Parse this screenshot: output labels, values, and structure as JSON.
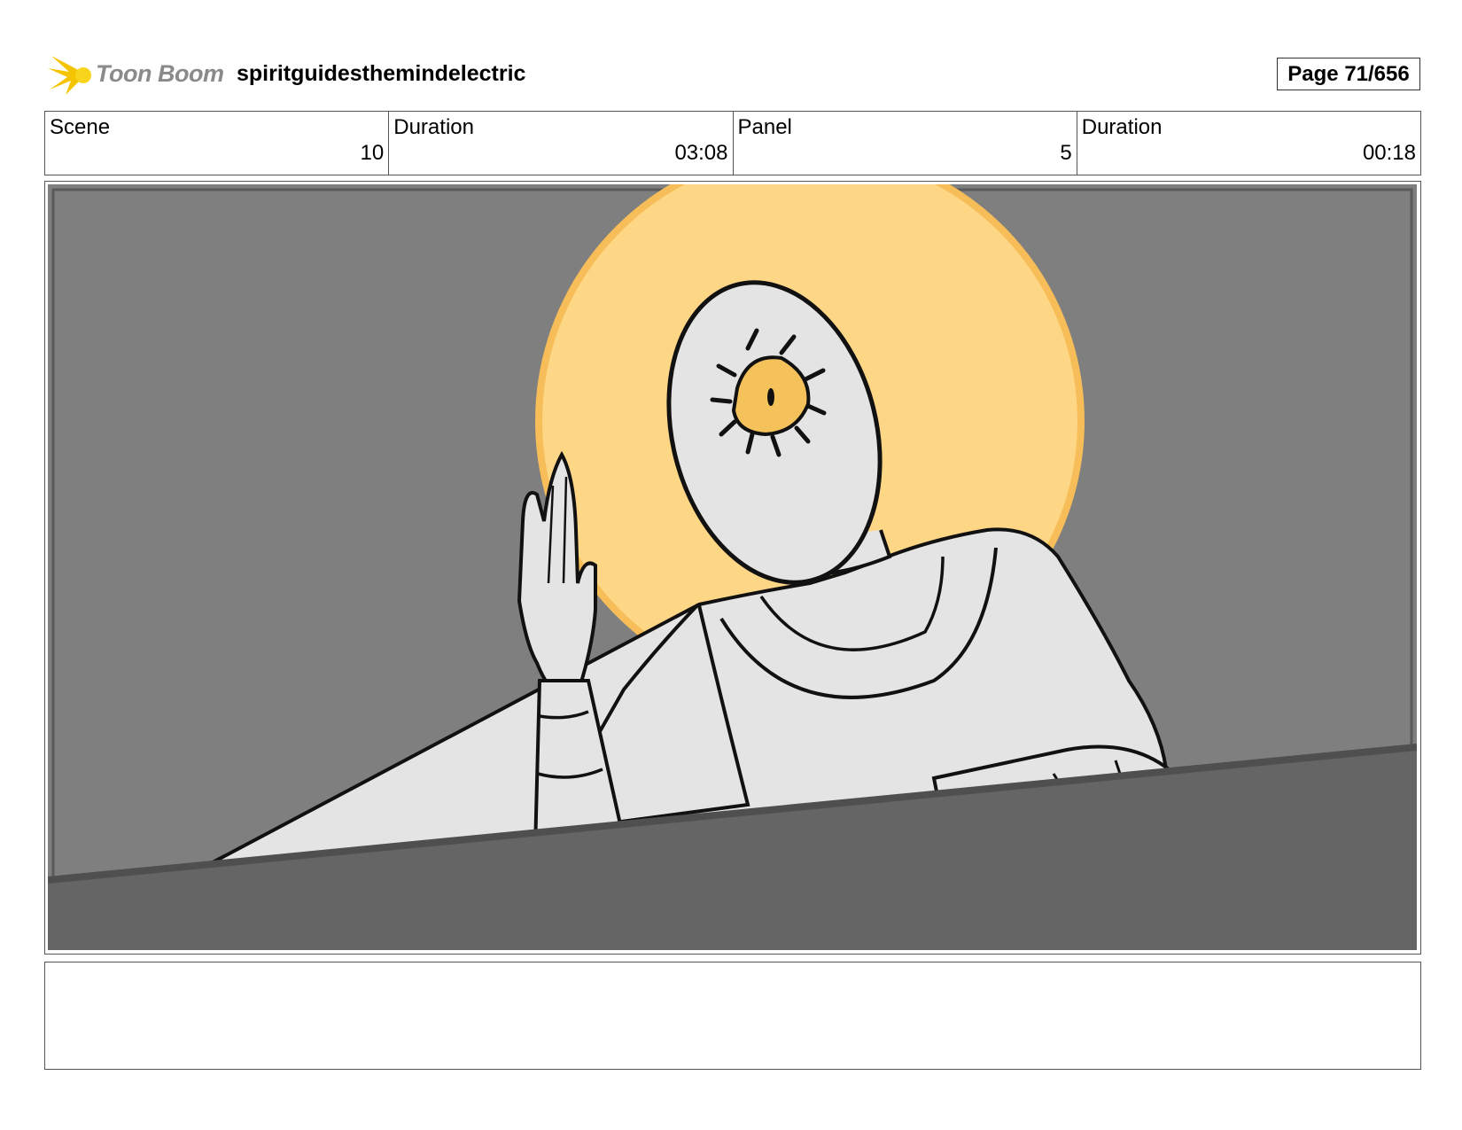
{
  "header": {
    "logo_text": "Toon Boom",
    "project_title": "spiritguidesthemindelectric",
    "page_label": "Page  71/656"
  },
  "info": {
    "scene_label": "Scene",
    "scene_value": "10",
    "scene_duration_label": "Duration",
    "scene_duration_value": "03:08",
    "panel_label": "Panel",
    "panel_value": "5",
    "panel_duration_label": "Duration",
    "panel_duration_value": "00:18"
  },
  "notes": {
    "text": ""
  },
  "colors": {
    "background_gray": "#7f7f7f",
    "foreground_gray": "#656565",
    "halo": "#fdd686",
    "halo_rim": "#f6bd58",
    "figure": "#e4e4e4",
    "eye": "#f4c15a"
  }
}
